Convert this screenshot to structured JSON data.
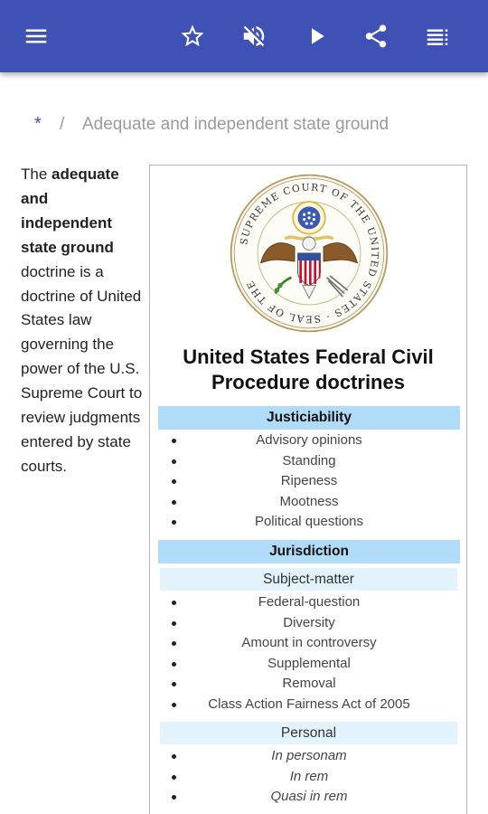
{
  "appbar": {
    "color": "#3f51b5",
    "icons": [
      "menu-icon",
      "star-outline-icon",
      "volume-off-icon",
      "play-icon",
      "share-icon",
      "playlist-icon"
    ]
  },
  "breadcrumb": {
    "home": "*",
    "separator": "/",
    "current": "Adequate and independent state ground"
  },
  "lead": {
    "intro": "The ",
    "bold": "adequate and independent state ground",
    "rest": " doctrine is a doctrine of United States law governing the power of the U.S. Supreme Court to review judgments entered by state courts."
  },
  "infobox": {
    "seal_text": "SUPREME COURT OF THE UNITED STATES · SEAL OF THE",
    "title": "United States Federal Civil Procedure doctrines",
    "sections": [
      {
        "header": "Justiciability",
        "items": [
          "Advisory opinions",
          "Standing",
          "Ripeness",
          "Mootness",
          "Political questions"
        ]
      },
      {
        "header": "Jurisdiction",
        "subsections": [
          {
            "label": "Subject-matter",
            "items": [
              "Federal-question",
              "Diversity",
              "Amount in controversy",
              "Supplemental",
              "Removal",
              "Class Action Fairness Act of 2005"
            ]
          },
          {
            "label": "Personal",
            "items": [
              "In personam",
              "In rem",
              "Quasi in rem"
            ]
          }
        ]
      }
    ]
  }
}
